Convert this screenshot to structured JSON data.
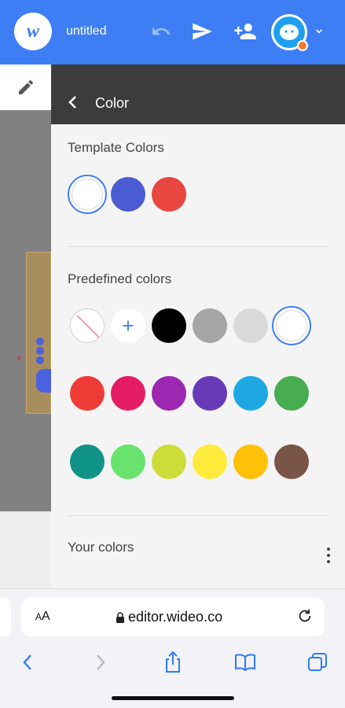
{
  "app": {
    "logo_letter": "w",
    "title": "untitled",
    "brand_color": "#3d7ef5"
  },
  "icons": {
    "undo": "undo-icon",
    "send": "send-icon",
    "add_user": "add-user-icon",
    "avatar": "avatar-icon",
    "chevron": "chevron-down-icon",
    "edit": "pencil-icon",
    "back": "chevron-left-icon",
    "more": "more-vertical-icon"
  },
  "panel": {
    "title": "Color",
    "template_section": "Template Colors",
    "predefined_section": "Predefined colors",
    "your_section": "Your colors",
    "template_colors": [
      "#ffffff",
      "#4a5bd4",
      "#e94640"
    ],
    "template_selected": 0,
    "predefined_row1": [
      "none",
      "add",
      "#000000",
      "#a6a6a6",
      "#d9d9d9",
      "#ffffff"
    ],
    "predefined_row1_selected": 5,
    "predefined_row2": [
      "#ef3b36",
      "#e41c63",
      "#9c28b1",
      "#683ab7",
      "#1ea8e3",
      "#47ad50"
    ],
    "predefined_row3": [
      "#0f9386",
      "#68e36d",
      "#cddc39",
      "#ffeb3b",
      "#ffc107",
      "#795548"
    ],
    "add_symbol": "+"
  },
  "browser": {
    "aa_label_big": "A",
    "aa_label_small": "A",
    "url": "editor.wideo.co"
  }
}
